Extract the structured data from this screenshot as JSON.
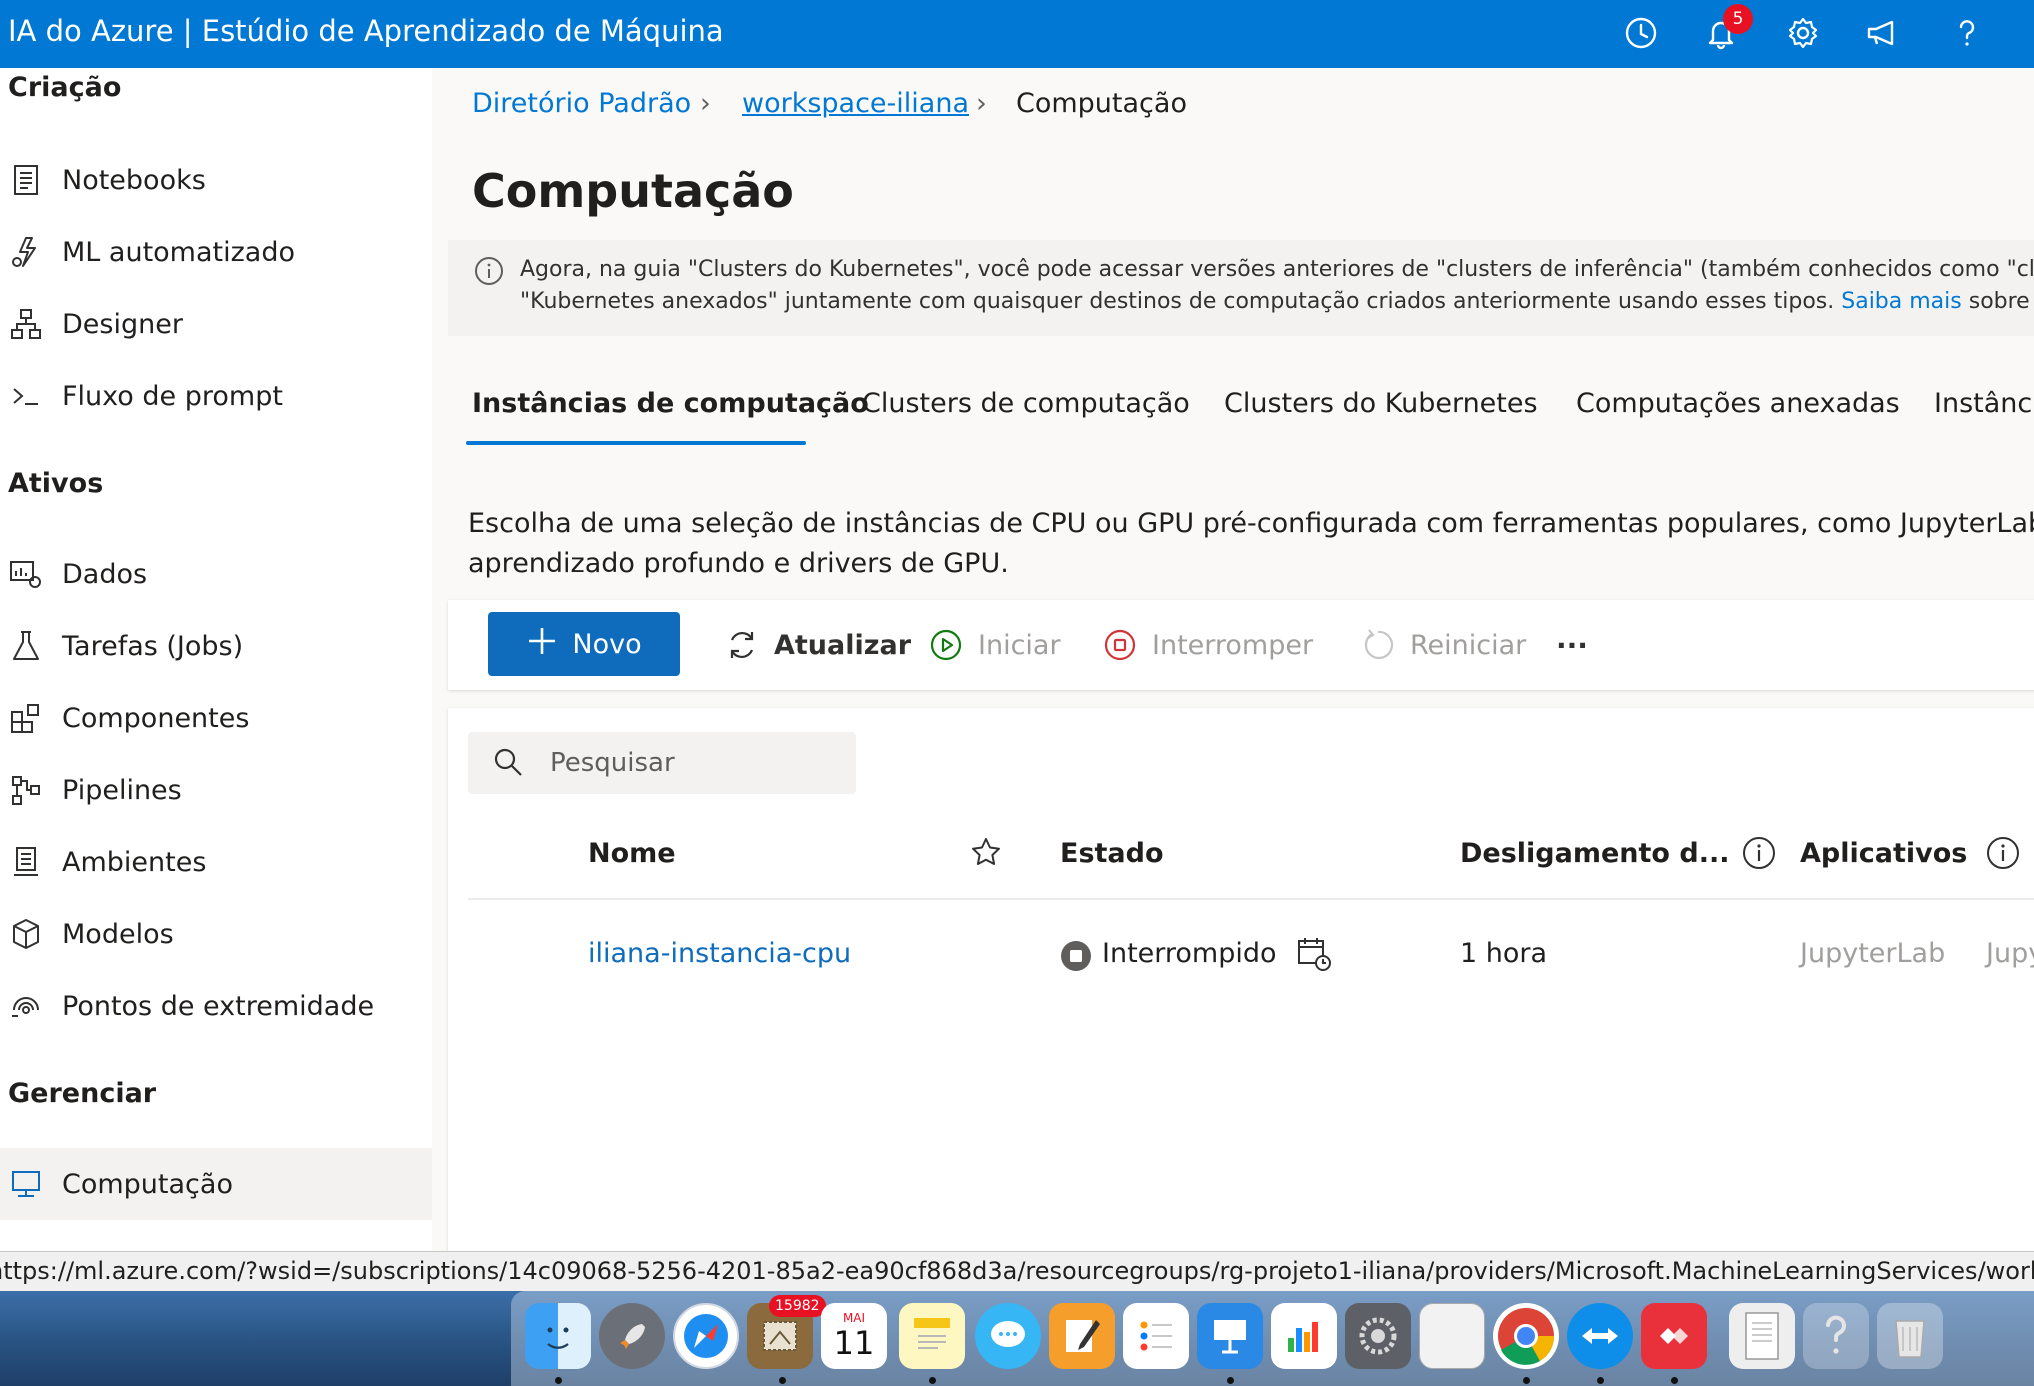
{
  "app": {
    "title": "IA do Azure | Estúdio de Aprendizado de Máquina",
    "notification_count": "5"
  },
  "sidebar": {
    "sections": {
      "criacao": "Criação",
      "ativos": "Ativos",
      "gerenciar": "Gerenciar"
    },
    "items": [
      {
        "label": "Notebooks",
        "icon": "notebook-icon"
      },
      {
        "label": "ML automatizado",
        "icon": "automl-icon"
      },
      {
        "label": "Designer",
        "icon": "designer-icon"
      },
      {
        "label": "Fluxo de prompt",
        "icon": "prompt-flow-icon"
      },
      {
        "label": "Dados",
        "icon": "data-icon"
      },
      {
        "label": "Tarefas (Jobs)",
        "icon": "jobs-flask-icon"
      },
      {
        "label": "Componentes",
        "icon": "components-icon"
      },
      {
        "label": "Pipelines",
        "icon": "pipelines-icon"
      },
      {
        "label": "Ambientes",
        "icon": "environments-icon"
      },
      {
        "label": "Modelos",
        "icon": "models-cube-icon"
      },
      {
        "label": "Pontos de extremidade",
        "icon": "endpoints-icon"
      },
      {
        "label": "Computação",
        "icon": "compute-monitor-icon"
      }
    ]
  },
  "breadcrumb": {
    "root": "Diretório Padrão",
    "workspace": "workspace-iliana",
    "current": "Computação"
  },
  "page": {
    "title": "Computação"
  },
  "info": {
    "line1": "Agora, na guia \"Clusters do Kubernetes\", você pode acessar versões anteriores de \"clusters de inferência\" (também conhecidos como \"clusters d",
    "line2_before": "\"Kubernetes anexados\" juntamente com quaisquer destinos de computação criados anteriormente usando esses tipos. ",
    "link": "Saiba mais",
    "line2_after": " sobre os clus"
  },
  "tabs": [
    "Instâncias de computação",
    "Clusters de computação",
    "Clusters do Kubernetes",
    "Computações anexadas",
    "Instância"
  ],
  "description": {
    "line1": "Escolha de uma seleção de instâncias de CPU ou GPU pré-configurada com ferramentas populares, como JupyterLab, Jupyter e",
    "line2": "aprendizado profundo e drivers de GPU."
  },
  "toolbar": {
    "new": "Novo",
    "refresh": "Atualizar",
    "start": "Iniciar",
    "stop": "Interromper",
    "restart": "Reiniciar",
    "more": "···"
  },
  "search": {
    "placeholder": "Pesquisar"
  },
  "table": {
    "columns": {
      "name": "Nome",
      "state": "Estado",
      "shutdown": "Desligamento d...",
      "apps": "Aplicativos"
    },
    "rows": [
      {
        "name": "iliana-instancia-cpu",
        "state": "Interrompido",
        "shutdown": "1 hora",
        "app1": "JupyterLab",
        "app2": "Jupyte"
      }
    ]
  },
  "statusbar": {
    "url": "https://ml.azure.com/?wsid=/subscriptions/14c09068-5256-4201-85a2-ea90cf868d3a/resourcegroups/rg-projeto1-iliana/providers/Microsoft.MachineLearningServices/workspaces"
  },
  "dock": {
    "mail_badge": "15982",
    "calendar_month": "MAI",
    "calendar_day": "11"
  },
  "colors": {
    "accent": "#0078d4",
    "button": "#0f6cbd",
    "stop_red": "#d13438",
    "start_green": "#107c10"
  }
}
